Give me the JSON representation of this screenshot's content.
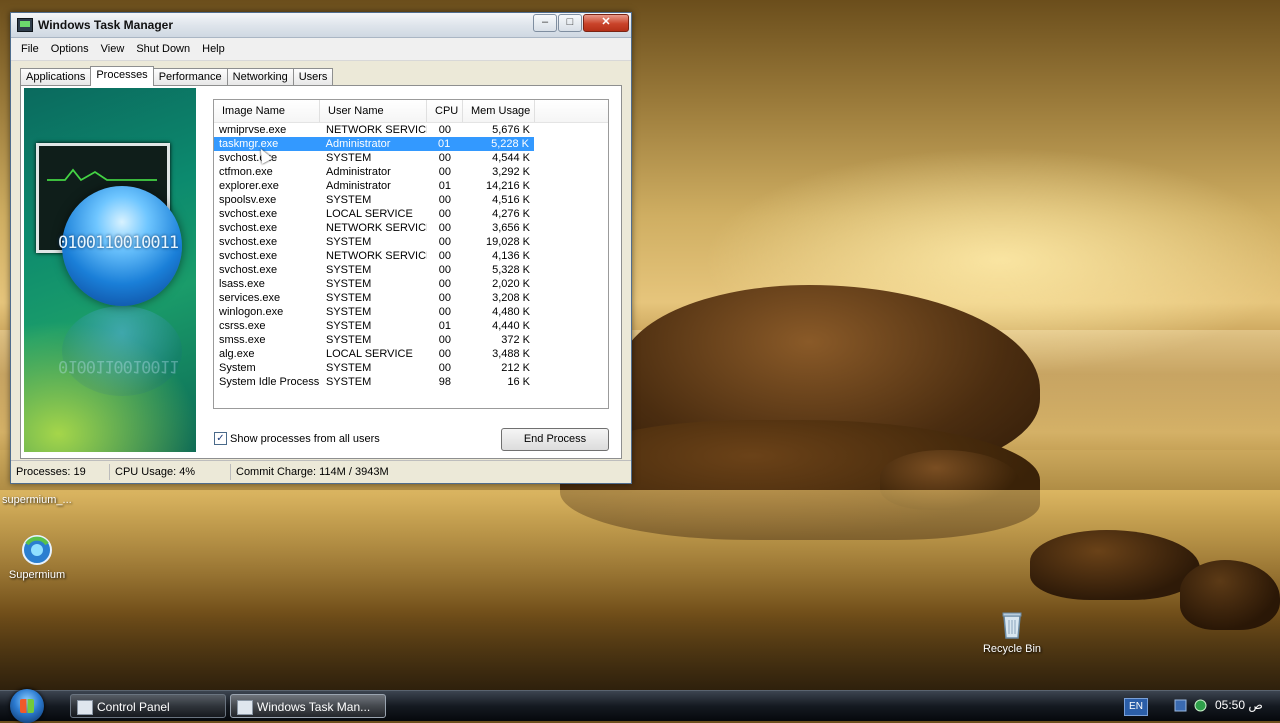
{
  "desktop": {
    "left_cut_label": "supermium_...",
    "icons": [
      {
        "label": "Supermium"
      },
      {
        "label": "Recycle Bin"
      }
    ]
  },
  "window": {
    "title": "Windows Task Manager",
    "controls": {
      "minimize": "–",
      "maximize": "□",
      "close": "✕"
    },
    "menu": [
      "File",
      "Options",
      "View",
      "Shut Down",
      "Help"
    ],
    "tabs": [
      "Applications",
      "Processes",
      "Performance",
      "Networking",
      "Users"
    ],
    "active_tab": "Processes",
    "art": {
      "binary": "0100110010011"
    },
    "columns": [
      "Image Name",
      "User Name",
      "CPU",
      "Mem Usage"
    ],
    "processes": [
      {
        "name": "wmiprvse.exe",
        "user": "NETWORK SERVICE",
        "cpu": "00",
        "mem": "5,676 K"
      },
      {
        "name": "taskmgr.exe",
        "user": "Administrator",
        "cpu": "01",
        "mem": "5,228 K"
      },
      {
        "name": "svchost.exe",
        "user": "SYSTEM",
        "cpu": "00",
        "mem": "4,544 K"
      },
      {
        "name": "ctfmon.exe",
        "user": "Administrator",
        "cpu": "00",
        "mem": "3,292 K"
      },
      {
        "name": "explorer.exe",
        "user": "Administrator",
        "cpu": "01",
        "mem": "14,216 K"
      },
      {
        "name": "spoolsv.exe",
        "user": "SYSTEM",
        "cpu": "00",
        "mem": "4,516 K"
      },
      {
        "name": "svchost.exe",
        "user": "LOCAL SERVICE",
        "cpu": "00",
        "mem": "4,276 K"
      },
      {
        "name": "svchost.exe",
        "user": "NETWORK SERVICE",
        "cpu": "00",
        "mem": "3,656 K"
      },
      {
        "name": "svchost.exe",
        "user": "SYSTEM",
        "cpu": "00",
        "mem": "19,028 K"
      },
      {
        "name": "svchost.exe",
        "user": "NETWORK SERVICE",
        "cpu": "00",
        "mem": "4,136 K"
      },
      {
        "name": "svchost.exe",
        "user": "SYSTEM",
        "cpu": "00",
        "mem": "5,328 K"
      },
      {
        "name": "lsass.exe",
        "user": "SYSTEM",
        "cpu": "00",
        "mem": "2,020 K"
      },
      {
        "name": "services.exe",
        "user": "SYSTEM",
        "cpu": "00",
        "mem": "3,208 K"
      },
      {
        "name": "winlogon.exe",
        "user": "SYSTEM",
        "cpu": "00",
        "mem": "4,480 K"
      },
      {
        "name": "csrss.exe",
        "user": "SYSTEM",
        "cpu": "01",
        "mem": "4,440 K"
      },
      {
        "name": "smss.exe",
        "user": "SYSTEM",
        "cpu": "00",
        "mem": "372 K"
      },
      {
        "name": "alg.exe",
        "user": "LOCAL SERVICE",
        "cpu": "00",
        "mem": "3,488 K"
      },
      {
        "name": "System",
        "user": "SYSTEM",
        "cpu": "00",
        "mem": "212 K"
      },
      {
        "name": "System Idle Process",
        "user": "SYSTEM",
        "cpu": "98",
        "mem": "16 K"
      }
    ],
    "selected_index": 1,
    "show_all_label": "Show processes from all users",
    "show_all_checked": "✓",
    "end_process_label": "End Process",
    "status": {
      "processes": "Processes: 19",
      "cpu": "CPU Usage: 4%",
      "commit": "Commit Charge: 114M / 3943M"
    }
  },
  "taskbar": {
    "tasks": [
      {
        "label": "Control Panel"
      },
      {
        "label": "Windows Task Man..."
      }
    ],
    "language": "EN",
    "clock": "05:50 ص"
  }
}
